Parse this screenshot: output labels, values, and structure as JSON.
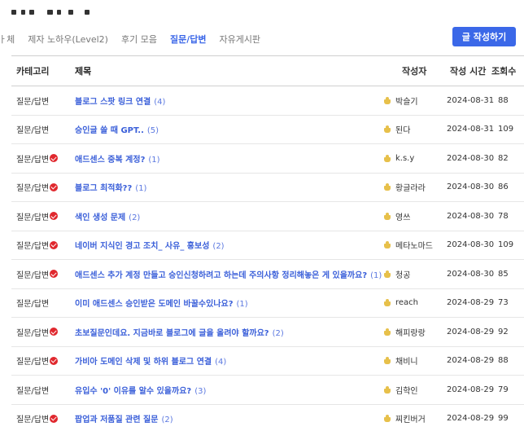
{
  "tabs": [
    {
      "label": "ㅏ체",
      "active": false
    },
    {
      "label": "제자 노하우(Level2)",
      "active": false
    },
    {
      "label": "후기 모음",
      "active": false
    },
    {
      "label": "질문/답변",
      "active": true
    },
    {
      "label": "자유게시판",
      "active": false
    }
  ],
  "write_button": "글 작성하기",
  "columns": {
    "category": "카테고리",
    "title": "제목",
    "author": "작성자",
    "date": "작성 시간",
    "views": "조회수"
  },
  "rows": [
    {
      "category": "질문/답변",
      "solved": false,
      "title": "블로그 스팟 링크 연결",
      "count": "(4)",
      "author": "박슬기",
      "date": "2024-08-31",
      "views": "88"
    },
    {
      "category": "질문/답변",
      "solved": false,
      "title": "승인글 쓸 때 GPT..",
      "count": "(5)",
      "author": "된다",
      "date": "2024-08-31",
      "views": "109"
    },
    {
      "category": "질문/답변",
      "solved": true,
      "title": "애드센스 중복 계정?",
      "count": "(1)",
      "author": "k.s.y",
      "date": "2024-08-30",
      "views": "82"
    },
    {
      "category": "질문/답변",
      "solved": true,
      "title": "블로그 최적화??",
      "count": "(1)",
      "author": "황글라라",
      "date": "2024-08-30",
      "views": "86"
    },
    {
      "category": "질문/답변",
      "solved": true,
      "title": "색인 생성 문제",
      "count": "(2)",
      "author": "영쓰",
      "date": "2024-08-30",
      "views": "78"
    },
    {
      "category": "질문/답변",
      "solved": true,
      "title": "네이버 지식인 경고 조치_ 사유_ 홍보성",
      "count": "(2)",
      "author": "메타노마드",
      "date": "2024-08-30",
      "views": "109"
    },
    {
      "category": "질문/답변",
      "solved": true,
      "title": "애드센스 추가 계정 만들고 승인신청하려고 하는데 주의사항 정리해놓은 게 있을까요?",
      "count": "(1)",
      "author": "청공",
      "date": "2024-08-30",
      "views": "85"
    },
    {
      "category": "질문/답변",
      "solved": false,
      "title": "이미 애드센스 승인받은 도메인 바꿀수있나요?",
      "count": "(1)",
      "author": "reach",
      "date": "2024-08-29",
      "views": "73"
    },
    {
      "category": "질문/답변",
      "solved": true,
      "title": "초보질문인데요. 지금바로 블로그에 글을 올려야 할까요?",
      "count": "(2)",
      "author": "해피랑랑",
      "date": "2024-08-29",
      "views": "92"
    },
    {
      "category": "질문/답변",
      "solved": true,
      "title": "가비아 도메인 삭제 및 하위 블로그 연결",
      "count": "(4)",
      "author": "채비니",
      "date": "2024-08-29",
      "views": "88"
    },
    {
      "category": "질문/답변",
      "solved": false,
      "title": "유입수 '0' 이유를 알수 있을까요?",
      "count": "(3)",
      "author": "김학인",
      "date": "2024-08-29",
      "views": "79"
    },
    {
      "category": "질문/답변",
      "solved": true,
      "title": "팝업과 저품질 관련 질문",
      "count": "(2)",
      "author": "찌킨버거",
      "date": "2024-08-29",
      "views": "99"
    }
  ]
}
